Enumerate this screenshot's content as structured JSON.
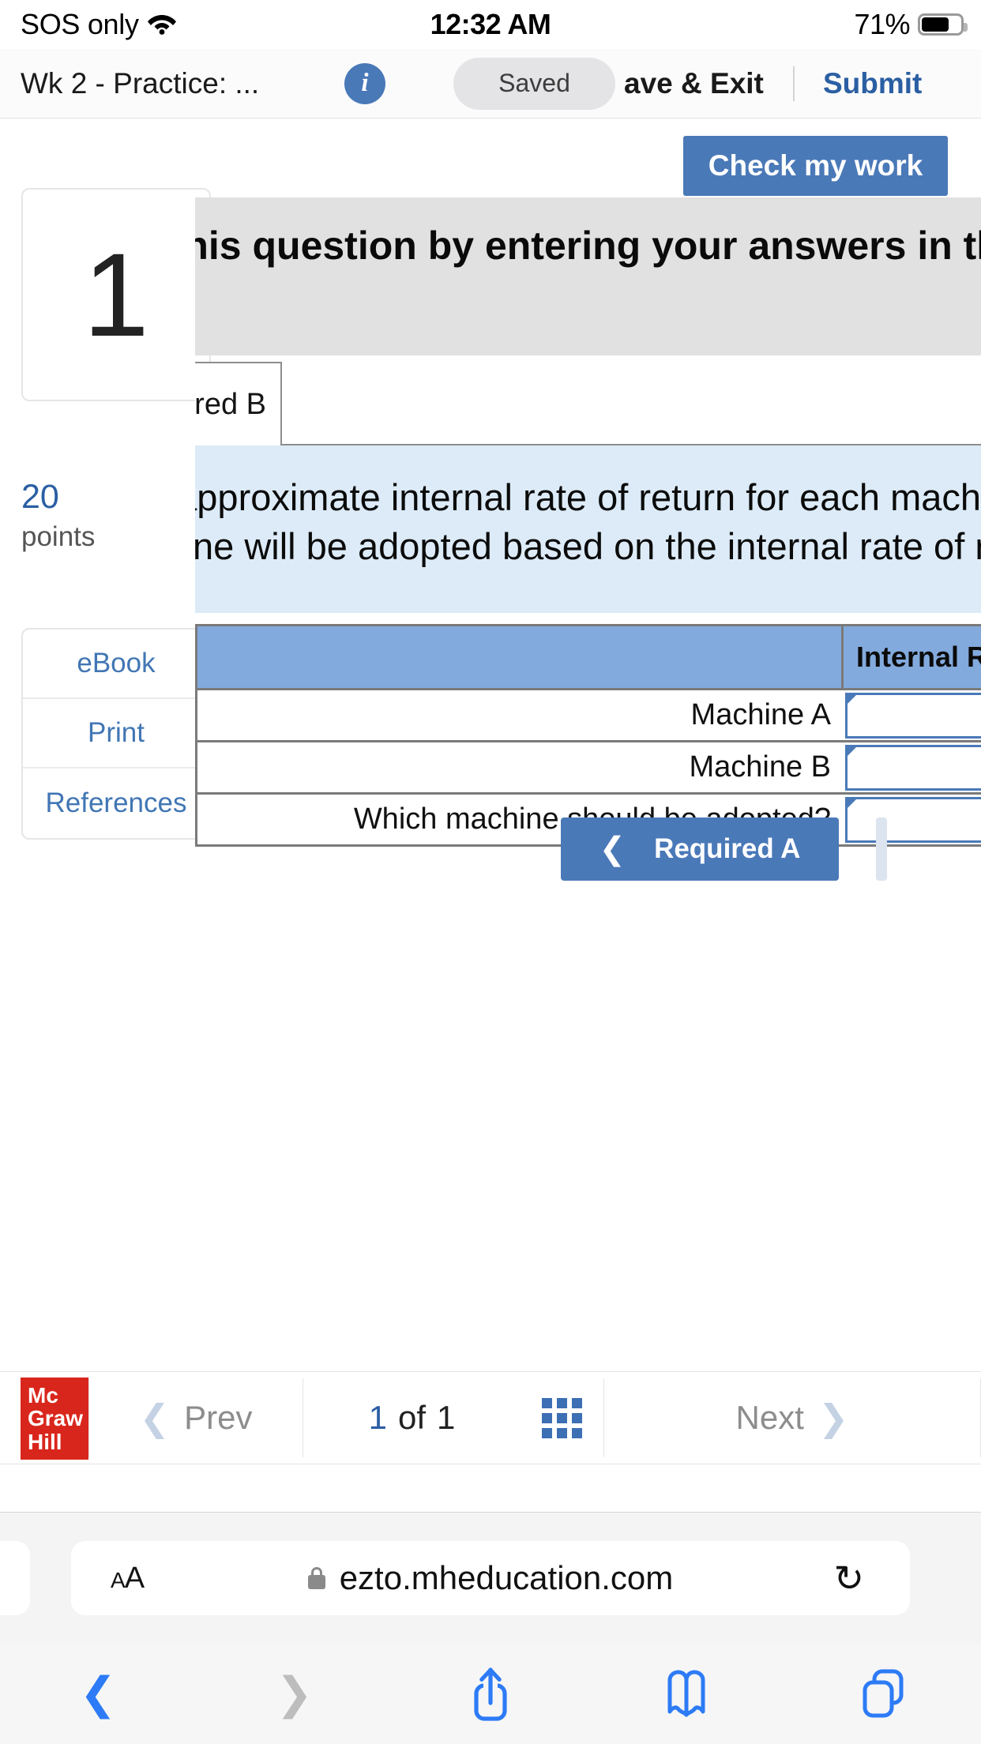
{
  "status_bar": {
    "carrier": "SOS only",
    "wifi_icon": "wifi-icon",
    "time": "12:32 AM",
    "battery_percent": "71%",
    "battery_icon": "battery-icon"
  },
  "app_header": {
    "title": "Wk 2 - Practice: ...",
    "info_icon": "info-icon",
    "saved_badge": "Saved",
    "save_exit_label": "ave & Exit",
    "submit_label": "Submit"
  },
  "left_rail": {
    "question_number": "1",
    "points_value": "20",
    "points_label": "points",
    "tools": [
      {
        "label": "eBook"
      },
      {
        "label": "Print"
      },
      {
        "label": "References"
      }
    ]
  },
  "main": {
    "check_work_label": "Check my work",
    "instruction_banner": "Complete this question by entering your answers in the tabs below.",
    "tabs": [
      {
        "label": "Required A",
        "active": false
      },
      {
        "label": "Required B",
        "active": true
      }
    ],
    "visible_tab_label": "ired B",
    "prompt_line_1": "What is the approximate internal rate of return for each machine?",
    "prompt_line_2": "Which machine will be adopted based on the internal rate of return?",
    "answer_table": {
      "header_left": "",
      "header_right": "Internal Rate of Return",
      "rows": [
        {
          "label": "Machine A",
          "value": "",
          "unit": "%"
        },
        {
          "label": "Machine B",
          "value": "",
          "unit": "%"
        },
        {
          "label": "Which machine should be adopted?",
          "value": "",
          "unit": ""
        }
      ]
    },
    "prev_tab_button": "Required A",
    "prev_tab_chevron": "chevron-left-icon"
  },
  "footer_nav": {
    "logo_line_1": "Mc",
    "logo_line_2": "Graw",
    "logo_line_3": "Hill",
    "prev_label": "Prev",
    "page_current": "1",
    "page_of": "of",
    "page_total": "1",
    "grid_icon": "grid-view-icon",
    "next_label": "Next"
  },
  "browser": {
    "text_size_label": "AA",
    "lock_icon": "lock-icon",
    "url": "ezto.mheducation.com",
    "reload_icon": "reload-icon",
    "toolbar": {
      "back_icon": "chevron-left-icon",
      "forward_icon": "chevron-right-icon",
      "share_icon": "share-icon",
      "bookmarks_icon": "book-icon",
      "tabs_icon": "tabs-icon"
    }
  },
  "colors": {
    "accent_blue": "#4a79b8",
    "link_blue": "#2b5fa3",
    "table_header_blue": "#83aadd",
    "prompt_panel_blue": "#dcebf7",
    "banner_grey": "#e1e1e1",
    "mcgraw_red": "#d9261c",
    "safari_blue": "#2d7bf6"
  }
}
